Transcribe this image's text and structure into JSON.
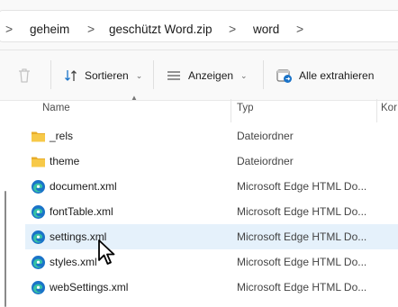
{
  "breadcrumb": {
    "chevron": ">",
    "items": [
      "geheim",
      "geschützt Word.zip",
      "word"
    ]
  },
  "toolbar": {
    "delete_icon": "trash-icon",
    "sort_label": "Sortieren",
    "view_label": "Anzeigen",
    "extract_label": "Alle extrahieren",
    "caret": "⌄"
  },
  "columns": {
    "name": "Name",
    "type": "Typ",
    "third": "Kor"
  },
  "files": [
    {
      "name": "_rels",
      "type": "Dateiordner",
      "icon": "folder-icon"
    },
    {
      "name": "theme",
      "type": "Dateiordner",
      "icon": "folder-icon"
    },
    {
      "name": "document.xml",
      "type": "Microsoft Edge HTML Do...",
      "icon": "edge-icon"
    },
    {
      "name": "fontTable.xml",
      "type": "Microsoft Edge HTML Do...",
      "icon": "edge-icon"
    },
    {
      "name": "settings.xml",
      "type": "Microsoft Edge HTML Do...",
      "icon": "edge-icon",
      "selected": true
    },
    {
      "name": "styles.xml",
      "type": "Microsoft Edge HTML Do...",
      "icon": "edge-icon"
    },
    {
      "name": "webSettings.xml",
      "type": "Microsoft Edge HTML Do...",
      "icon": "edge-icon"
    }
  ],
  "colors": {
    "selection": "#e5f1fb",
    "folder": "#f5c342",
    "edge_blue": "#1a73c8",
    "edge_teal": "#35c1a5"
  }
}
